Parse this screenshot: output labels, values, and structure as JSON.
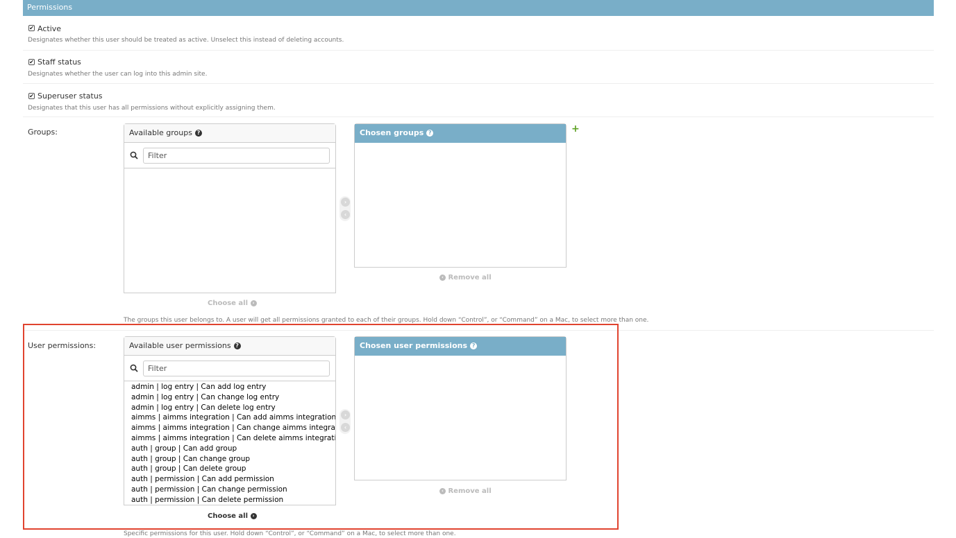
{
  "section": {
    "title": "Permissions"
  },
  "active": {
    "label": "Active",
    "help": "Designates whether this user should be treated as active. Unselect this instead of deleting accounts."
  },
  "staff": {
    "label": "Staff status",
    "help": "Designates whether the user can log into this admin site."
  },
  "superuser": {
    "label": "Superuser status",
    "help": "Designates that this user has all permissions without explicitly assigning them."
  },
  "checkmark": "✔",
  "groups": {
    "label": "Groups:",
    "available_title": "Available groups",
    "chosen_title": "Chosen groups",
    "filter_placeholder": "Filter",
    "choose_all": "Choose all",
    "remove_all": "Remove all",
    "help": "The groups this user belongs to. A user will get all permissions granted to each of their groups. Hold down “Control”, or “Command” on a Mac, to select more than one."
  },
  "user_permissions": {
    "label": "User permissions:",
    "available_title": "Available user permissions",
    "chosen_title": "Chosen user permissions",
    "filter_placeholder": "Filter",
    "choose_all": "Choose all",
    "remove_all": "Remove all",
    "help": "Specific permissions for this user. Hold down “Control”, or “Command” on a Mac, to select more than one.",
    "items": [
      "admin | log entry | Can add log entry",
      "admin | log entry | Can change log entry",
      "admin | log entry | Can delete log entry",
      "aimms | aimms integration | Can add aimms integration",
      "aimms | aimms integration | Can change aimms integration",
      "aimms | aimms integration | Can delete aimms integration",
      "auth | group | Can add group",
      "auth | group | Can change group",
      "auth | group | Can delete group",
      "auth | permission | Can add permission",
      "auth | permission | Can change permission",
      "auth | permission | Can delete permission"
    ]
  },
  "icons": {
    "help": "?",
    "add": "+",
    "right": "›",
    "left": "‹"
  },
  "colors": {
    "header": "#79aec8",
    "add": "#5fa224",
    "highlight": "#e0432f"
  }
}
